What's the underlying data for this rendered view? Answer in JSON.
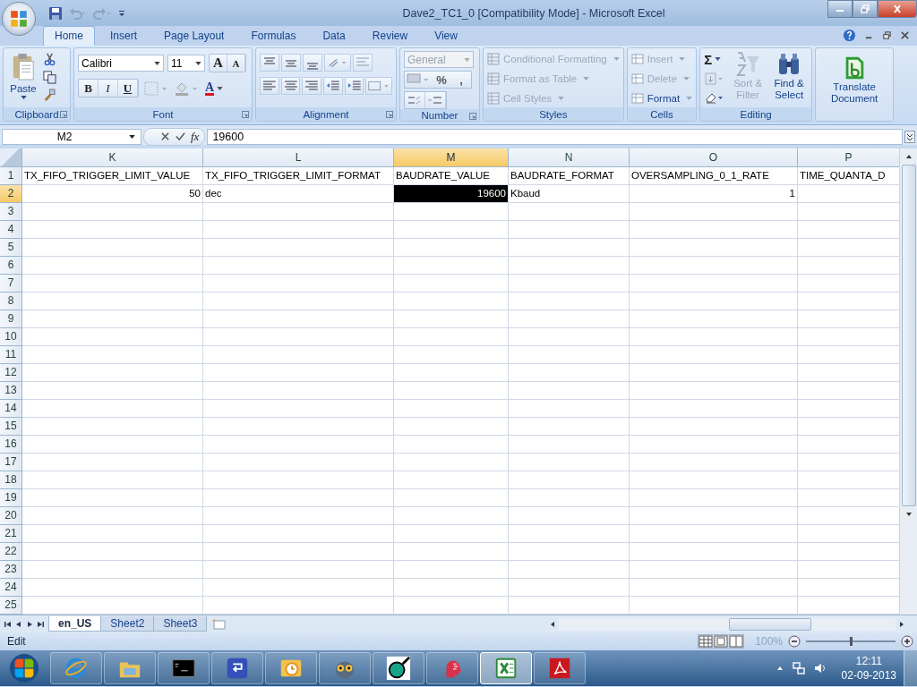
{
  "window": {
    "title": "Dave2_TC1_0  [Compatibility Mode] - Microsoft Excel"
  },
  "ribbon_tabs": [
    {
      "label": "Home",
      "selected": true
    },
    {
      "label": "Insert",
      "selected": false
    },
    {
      "label": "Page Layout",
      "selected": false
    },
    {
      "label": "Formulas",
      "selected": false
    },
    {
      "label": "Data",
      "selected": false
    },
    {
      "label": "Review",
      "selected": false
    },
    {
      "label": "View",
      "selected": false
    }
  ],
  "clipboard": {
    "paste": "Paste",
    "label": "Clipboard"
  },
  "font": {
    "family": "Calibri",
    "size": "11",
    "grow": "A",
    "shrink": "A",
    "bold": "B",
    "italic": "I",
    "underline": "U",
    "text_colour_letter": "A",
    "label": "Font"
  },
  "alignment": {
    "label": "Alignment"
  },
  "number": {
    "format": "General",
    "percent": "%",
    "comma": ",",
    "label": "Number"
  },
  "styles": {
    "items": [
      {
        "label": "Conditional Formatting",
        "disabled": true
      },
      {
        "label": "Format as Table",
        "disabled": true
      },
      {
        "label": "Cell Styles",
        "disabled": true
      }
    ],
    "label": "Styles"
  },
  "cells": {
    "items": [
      {
        "label": "Insert",
        "disabled": true
      },
      {
        "label": "Delete",
        "disabled": true
      },
      {
        "label": "Format",
        "disabled": false
      }
    ],
    "label": "Cells"
  },
  "editing": {
    "sum": "Σ",
    "sort": {
      "label": "Sort & Filter",
      "disabled": true
    },
    "find": {
      "label": "Find & Select",
      "disabled": false
    },
    "label": "Editing"
  },
  "translate": {
    "label": "Translate Document"
  },
  "formula_bar": {
    "name_box": "M2",
    "fx": "fx",
    "value": "19600"
  },
  "sheet": {
    "columns": [
      {
        "label": "K",
        "selected": false
      },
      {
        "label": "L",
        "selected": false
      },
      {
        "label": "M",
        "selected": true
      },
      {
        "label": "N",
        "selected": false
      },
      {
        "label": "O",
        "selected": false
      },
      {
        "label": "P",
        "selected": false
      }
    ],
    "rows": [
      {
        "label": "1",
        "selected": false,
        "cells": [
          {
            "text": "TX_FIFO_TRIGGER_LIMIT_VALUE",
            "kind": "text",
            "selected": false
          },
          {
            "text": "TX_FIFO_TRIGGER_LIMIT_FORMAT",
            "kind": "text",
            "selected": false
          },
          {
            "text": "BAUDRATE_VALUE",
            "kind": "text",
            "selected": false
          },
          {
            "text": "BAUDRATE_FORMAT",
            "kind": "text",
            "selected": false
          },
          {
            "text": "OVERSAMPLING_0_1_RATE",
            "kind": "text",
            "selected": false
          },
          {
            "text": "TIME_QUANTA_D",
            "kind": "text",
            "selected": false
          }
        ]
      },
      {
        "label": "2",
        "selected": true,
        "cells": [
          {
            "text": "50",
            "kind": "number",
            "selected": false
          },
          {
            "text": "dec",
            "kind": "text",
            "selected": false
          },
          {
            "text": "19600",
            "kind": "number",
            "selected": true
          },
          {
            "text": "Kbaud",
            "kind": "text",
            "selected": false
          },
          {
            "text": "1",
            "kind": "number",
            "selected": false
          }
        ]
      },
      {
        "label": "3",
        "selected": false
      },
      {
        "label": "4",
        "selected": false
      },
      {
        "label": "5",
        "selected": false
      },
      {
        "label": "6",
        "selected": false
      },
      {
        "label": "7",
        "selected": false
      },
      {
        "label": "8",
        "selected": false
      },
      {
        "label": "9",
        "selected": false
      },
      {
        "label": "10",
        "selected": false
      },
      {
        "label": "11",
        "selected": false
      },
      {
        "label": "12",
        "selected": false
      },
      {
        "label": "13",
        "selected": false
      },
      {
        "label": "14",
        "selected": false
      },
      {
        "label": "15",
        "selected": false
      },
      {
        "label": "16",
        "selected": false
      },
      {
        "label": "17",
        "selected": false
      },
      {
        "label": "18",
        "selected": false
      },
      {
        "label": "19",
        "selected": false
      },
      {
        "label": "20",
        "selected": false
      },
      {
        "label": "21",
        "selected": false
      },
      {
        "label": "22",
        "selected": false
      },
      {
        "label": "23",
        "selected": false
      },
      {
        "label": "24",
        "selected": false
      },
      {
        "label": "25",
        "selected": false
      }
    ]
  },
  "sheet_tabs": [
    {
      "label": "en_US",
      "selected": true
    },
    {
      "label": "Sheet2",
      "selected": false
    },
    {
      "label": "Sheet3",
      "selected": false
    }
  ],
  "status_bar": {
    "mode": "Edit",
    "zoom": "100%",
    "zoom_slider": {
      "level": 0.5
    }
  },
  "taskbar": {
    "apps": [
      {
        "kind": "browser",
        "selected": false
      },
      {
        "kind": "folder",
        "selected": false
      },
      {
        "kind": "terminal",
        "selected": false
      },
      {
        "kind": "sync",
        "selected": false
      },
      {
        "kind": "mail",
        "selected": false
      },
      {
        "kind": "owl",
        "selected": false
      },
      {
        "kind": "magnifier",
        "selected": false
      },
      {
        "kind": "head",
        "selected": false
      },
      {
        "kind": "spreadsheet",
        "selected": true
      },
      {
        "kind": "pdf",
        "selected": false
      }
    ],
    "time": "12:11",
    "date": "02-09-2013"
  }
}
